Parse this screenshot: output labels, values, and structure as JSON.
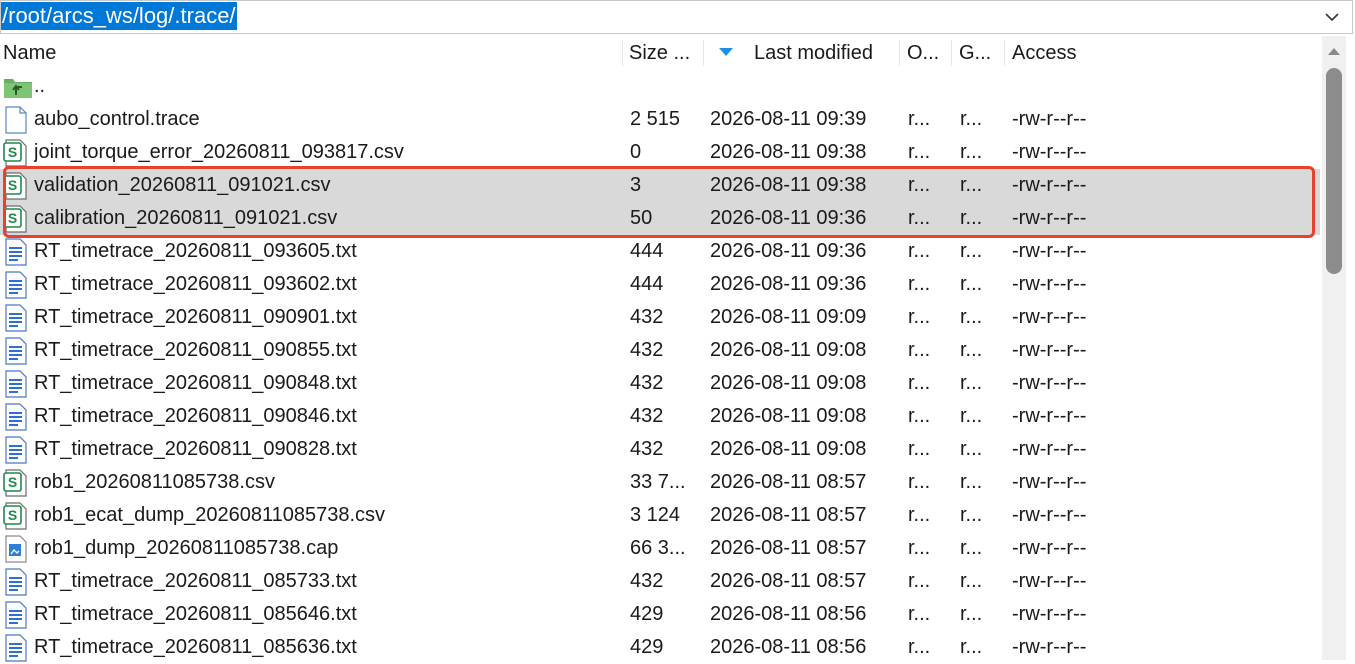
{
  "path": "/root/arcs_ws/log/.trace/",
  "header": {
    "name": "Name",
    "size": "Size ...",
    "last_modified": "Last modified",
    "owner": "O...",
    "group": "G...",
    "access": "Access"
  },
  "parent_dir": "..",
  "files": [
    {
      "icon": "document-icon",
      "name": "aubo_control.trace",
      "size": "2 515",
      "modified": "2026-08-11 09:39",
      "owner": "r...",
      "group": "r...",
      "access": "-rw-r--r--"
    },
    {
      "icon": "spreadsheet-icon",
      "name": "joint_torque_error_20260811_093817.csv",
      "size": "0",
      "modified": "2026-08-11 09:38",
      "owner": "r...",
      "group": "r...",
      "access": "-rw-r--r--"
    },
    {
      "icon": "spreadsheet-icon",
      "name": "validation_20260811_091021.csv",
      "size": "3",
      "modified": "2026-08-11 09:38",
      "owner": "r...",
      "group": "r...",
      "access": "-rw-r--r--",
      "selected": true
    },
    {
      "icon": "spreadsheet-icon",
      "name": "calibration_20260811_091021.csv",
      "size": "50",
      "modified": "2026-08-11 09:36",
      "owner": "r...",
      "group": "r...",
      "access": "-rw-r--r--",
      "selected": true
    },
    {
      "icon": "text-file-icon",
      "name": "RT_timetrace_20260811_093605.txt",
      "size": "444",
      "modified": "2026-08-11 09:36",
      "owner": "r...",
      "group": "r...",
      "access": "-rw-r--r--"
    },
    {
      "icon": "text-file-icon",
      "name": "RT_timetrace_20260811_093602.txt",
      "size": "444",
      "modified": "2026-08-11 09:36",
      "owner": "r...",
      "group": "r...",
      "access": "-rw-r--r--"
    },
    {
      "icon": "text-file-icon",
      "name": "RT_timetrace_20260811_090901.txt",
      "size": "432",
      "modified": "2026-08-11 09:09",
      "owner": "r...",
      "group": "r...",
      "access": "-rw-r--r--"
    },
    {
      "icon": "text-file-icon",
      "name": "RT_timetrace_20260811_090855.txt",
      "size": "432",
      "modified": "2026-08-11 09:08",
      "owner": "r...",
      "group": "r...",
      "access": "-rw-r--r--"
    },
    {
      "icon": "text-file-icon",
      "name": "RT_timetrace_20260811_090848.txt",
      "size": "432",
      "modified": "2026-08-11 09:08",
      "owner": "r...",
      "group": "r...",
      "access": "-rw-r--r--"
    },
    {
      "icon": "text-file-icon",
      "name": "RT_timetrace_20260811_090846.txt",
      "size": "432",
      "modified": "2026-08-11 09:08",
      "owner": "r...",
      "group": "r...",
      "access": "-rw-r--r--"
    },
    {
      "icon": "text-file-icon",
      "name": "RT_timetrace_20260811_090828.txt",
      "size": "432",
      "modified": "2026-08-11 09:08",
      "owner": "r...",
      "group": "r...",
      "access": "-rw-r--r--"
    },
    {
      "icon": "spreadsheet-icon",
      "name": "rob1_20260811085738.csv",
      "size": "33 7...",
      "modified": "2026-08-11 08:57",
      "owner": "r...",
      "group": "r...",
      "access": "-rw-r--r--"
    },
    {
      "icon": "spreadsheet-icon",
      "name": "rob1_ecat_dump_20260811085738.csv",
      "size": "3 124",
      "modified": "2026-08-11 08:57",
      "owner": "r...",
      "group": "r...",
      "access": "-rw-r--r--"
    },
    {
      "icon": "capture-file-icon",
      "name": "rob1_dump_20260811085738.cap",
      "size": "66 3...",
      "modified": "2026-08-11 08:57",
      "owner": "r...",
      "group": "r...",
      "access": "-rw-r--r--"
    },
    {
      "icon": "text-file-icon",
      "name": "RT_timetrace_20260811_085733.txt",
      "size": "432",
      "modified": "2026-08-11 08:57",
      "owner": "r...",
      "group": "r...",
      "access": "-rw-r--r--"
    },
    {
      "icon": "text-file-icon",
      "name": "RT_timetrace_20260811_085646.txt",
      "size": "429",
      "modified": "2026-08-11 08:56",
      "owner": "r...",
      "group": "r...",
      "access": "-rw-r--r--"
    },
    {
      "icon": "text-file-icon",
      "name": "RT_timetrace_20260811_085636.txt",
      "size": "429",
      "modified": "2026-08-11 08:56",
      "owner": "r...",
      "group": "r...",
      "access": "-rw-r--r--"
    }
  ],
  "colors": {
    "selection": "#d9d9d9",
    "highlight_border": "#e8412c",
    "path_selection": "#0078d7",
    "sort_indicator": "#1c8fe6"
  }
}
